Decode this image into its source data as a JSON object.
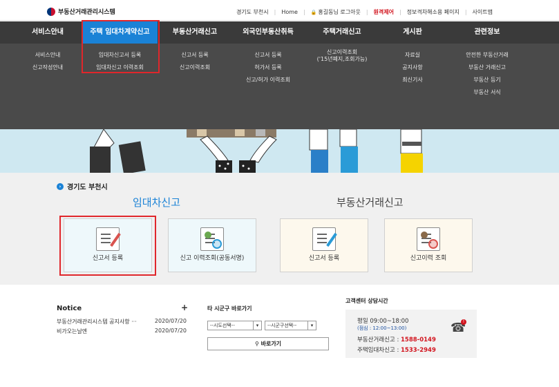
{
  "header": {
    "logo_text": "부동산거래관리시스템",
    "links": [
      {
        "label": "경기도 부천시"
      },
      {
        "label": "Home"
      },
      {
        "label": "홍길동님 로그아웃"
      },
      {
        "label": "원격제어"
      },
      {
        "label": "정보격차해소용 페이지"
      },
      {
        "label": "사이트맵"
      }
    ]
  },
  "nav": {
    "items": [
      {
        "label": "서비스안내"
      },
      {
        "label": "주택 임대차계약신고"
      },
      {
        "label": "부동산거래신고"
      },
      {
        "label": "외국인부동산취득"
      },
      {
        "label": "주택거래신고"
      },
      {
        "label": "게시판"
      },
      {
        "label": "관련정보"
      }
    ],
    "active_index": 1
  },
  "mega": {
    "col0": [
      "서비스안내",
      "신고작성안내"
    ],
    "col1": [
      "임대차신고서 등록",
      "임대차신고 이력조회"
    ],
    "col2": [
      "신고서 등록",
      "신고이력조회"
    ],
    "col3": [
      "신고서 등록",
      "허가서 등록",
      "신고/허가 이력조회"
    ],
    "col4": [
      "신고이력조회",
      "('15년폐지,조회가능)"
    ],
    "col5": [
      "자료실",
      "공지사항",
      "최신기사"
    ],
    "col6": [
      "안전한 부동산거래",
      "부동산 거래신고",
      "부동산 등기",
      "부동산 서식"
    ]
  },
  "main": {
    "location": "경기도 부천시",
    "section_rental": "임대차신고",
    "section_trade": "부동산거래신고",
    "cards": [
      {
        "label": "신고서 등록"
      },
      {
        "label": "신고 이력조회(공동서명)"
      },
      {
        "label": "신고서 등록"
      },
      {
        "label": "신고이력 조회"
      }
    ]
  },
  "notice": {
    "title": "Notice",
    "plus": "+",
    "rows": [
      {
        "title": "부동산거래관리시스템 공지사항 ···",
        "date": "2020/07/20"
      },
      {
        "title": "비가오는날엔",
        "date": "2020/07/20"
      }
    ]
  },
  "shortcut": {
    "title": "타 시군구 바로가기",
    "select_sido": "--시도선택--",
    "select_sigungu": "--시군구선택--",
    "go_label": "바로가기"
  },
  "customer_center": {
    "title": "고객센터 상담시간",
    "weekday": "평일 09:00~18:00",
    "lunch": "(점심 : 12:00~13:00)",
    "trade_label": "부동산거래신고 : ",
    "trade_phone": "1588-0149",
    "rental_label": "주택임대차신고 : ",
    "rental_phone": "1533-2949"
  }
}
